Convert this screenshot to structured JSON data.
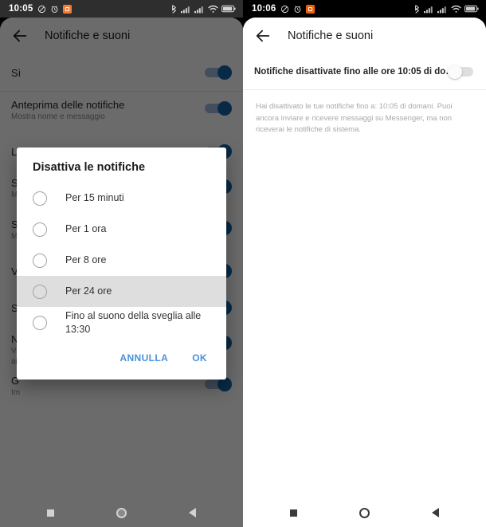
{
  "left": {
    "statusbar": {
      "time": "10:05",
      "icons": [
        "dnd-icon",
        "alarm-icon",
        "app-badge-icon"
      ],
      "right_icons": [
        "bluetooth-icon",
        "signal-icon",
        "signal-icon-2",
        "wifi-icon",
        "battery-icon"
      ]
    },
    "appbar": {
      "back_icon": "back-arrow-icon",
      "title": "Notifiche e suoni"
    },
    "rows": [
      {
        "title": "Sì",
        "sub": "",
        "toggle": "on"
      },
      {
        "title": "Anteprima delle notifiche",
        "sub": "Mostra nome e messaggio",
        "toggle": "on"
      },
      {
        "title": "Led di notifica",
        "sub": "",
        "toggle": "on"
      },
      {
        "title": "Su",
        "sub": "Mo",
        "toggle": "on"
      },
      {
        "title": "Su",
        "sub": "Mo",
        "toggle": "on"
      },
      {
        "title": "Vi",
        "sub": "",
        "toggle": "on"
      },
      {
        "title": "Su",
        "sub": "",
        "toggle": "on"
      },
      {
        "title": "N",
        "sub": "Vi",
        "sub2": "an",
        "toggle": "on"
      },
      {
        "title": "G",
        "sub": "Im",
        "toggle": "on"
      }
    ],
    "navbar": {
      "recents": "square-icon",
      "home": "circle-icon",
      "back": "triangle-icon"
    }
  },
  "dialog": {
    "title": "Disattiva le notifiche",
    "options": [
      {
        "label": "Per 15 minuti",
        "selected": false,
        "pressed": false
      },
      {
        "label": "Per 1 ora",
        "selected": false,
        "pressed": false
      },
      {
        "label": "Per 8 ore",
        "selected": false,
        "pressed": false
      },
      {
        "label": "Per 24 ore",
        "selected": false,
        "pressed": true
      },
      {
        "label": "Fino al suono della sveglia alle 13:30",
        "selected": false,
        "pressed": false
      }
    ],
    "cancel_label": "ANNULLA",
    "ok_label": "OK",
    "accent_color": "#4a90d9"
  },
  "right": {
    "statusbar": {
      "time": "10:06",
      "icons": [
        "dnd-icon",
        "alarm-icon",
        "app-badge-icon"
      ],
      "right_icons": [
        "bluetooth-icon",
        "signal-icon",
        "signal-icon-2",
        "wifi-icon",
        "battery-icon"
      ]
    },
    "appbar": {
      "back_icon": "back-arrow-icon",
      "title": "Notifiche e suoni"
    },
    "mute_row": {
      "title": "Notifiche disattivate fino alle ore 10:05 di do…",
      "toggle": "off"
    },
    "description": "Hai disattivato le tue notifiche fino a: 10:05 di domani. Puoi ancora inviare e ricevere messaggi su Messenger, ma non riceverai le notifiche di sistema.",
    "navbar": {
      "recents": "square-icon",
      "home": "circle-icon",
      "back": "triangle-icon"
    }
  }
}
